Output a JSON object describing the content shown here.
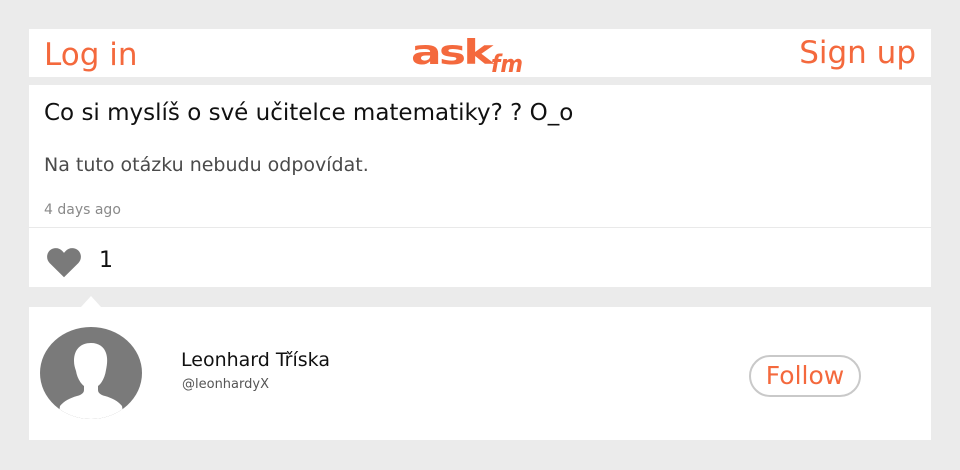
{
  "header": {
    "login_label": "Log in",
    "logo_text": "ASKfm",
    "signup_label": "Sign up"
  },
  "question": {
    "text": "Co si myslíš o své učitelce matematiky? ? O_o",
    "answer": "Na tuto otázku nebudu odpovídat.",
    "time_ago": "4 days ago",
    "likes": "1"
  },
  "user": {
    "name": "Leonhard Tříska",
    "handle": "@leonhardyX",
    "follow_label": "Follow"
  },
  "icons": {
    "logo": "askfm-logo",
    "like": "heart-icon",
    "avatar": "default-avatar-silhouette"
  },
  "colors": {
    "accent": "#f4693d",
    "page_background": "#ebebeb",
    "card_background": "#ffffff",
    "icon_gray": "#7a7a7a"
  }
}
